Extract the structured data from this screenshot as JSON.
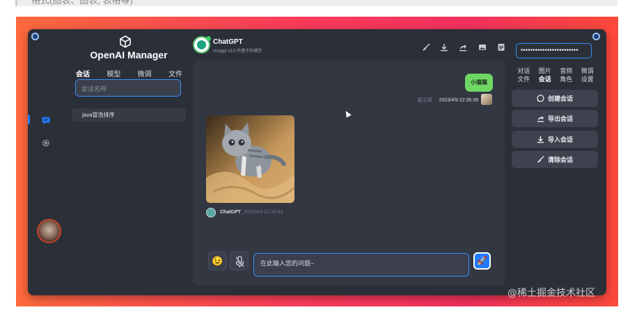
{
  "page": {
    "top_strip_text": "格式(图表、图表, 表格等)",
    "watermark": "@稀土掘金技术社区"
  },
  "colors": {
    "accent": "#1e7bff",
    "window_bg": "#2b2f38",
    "panel_bg": "#323742",
    "user_bubble": "#6fd864",
    "gradient_start": "#ff6a3d",
    "gradient_end": "#f2315e"
  },
  "rail": {
    "items": [
      {
        "icon": "chat-icon",
        "active": true
      },
      {
        "icon": "gear-icon",
        "active": false
      }
    ],
    "avatar_icon": "user-avatar"
  },
  "sidebar": {
    "brand_icon": "cube-icon",
    "brand": "OpenAI Manager",
    "tabs": [
      {
        "label": "会话",
        "active": true
      },
      {
        "label": "模型"
      },
      {
        "label": "微调"
      },
      {
        "label": "文件"
      }
    ],
    "search_placeholder": "会话名称",
    "conversations": [
      {
        "title": "java冒泡排序"
      }
    ]
  },
  "chat": {
    "title": "ChatGPT",
    "subtitle": "chatgpt v3.5 所基于的模型",
    "header_icons": [
      "broom-icon",
      "download-icon",
      "share-icon",
      "image-icon",
      "notes-icon"
    ],
    "messages": [
      {
        "role": "user",
        "text": "小猫猫",
        "author": "星尘雨",
        "time": "2023/4/9 22:35:39"
      },
      {
        "role": "assistant",
        "type": "image",
        "image_desc": "kitten",
        "author": "ChatGPT",
        "time": "2023/4/9 22:35:44"
      }
    ],
    "input_placeholder": "在此输入您的问题~",
    "emoji_icon": "emoji-icon",
    "mic_icon": "mic-off-icon",
    "send_icon": "rocket-icon"
  },
  "api_key_field": {
    "value": "••••••••••••••••••••••••"
  },
  "right_panel": {
    "tabs": [
      {
        "label": "对话"
      },
      {
        "label": "图片"
      },
      {
        "label": "音频"
      },
      {
        "label": "微调"
      },
      {
        "label": "文件"
      },
      {
        "label": "会话",
        "active": true
      },
      {
        "label": "角色"
      },
      {
        "label": "设置"
      }
    ],
    "actions": [
      {
        "label": "创建会话",
        "icon": "whatsapp-icon"
      },
      {
        "label": "导出会话",
        "icon": "share-icon"
      },
      {
        "label": "导入会话",
        "icon": "download-icon"
      },
      {
        "label": "清除会话",
        "icon": "broom-icon"
      }
    ]
  }
}
